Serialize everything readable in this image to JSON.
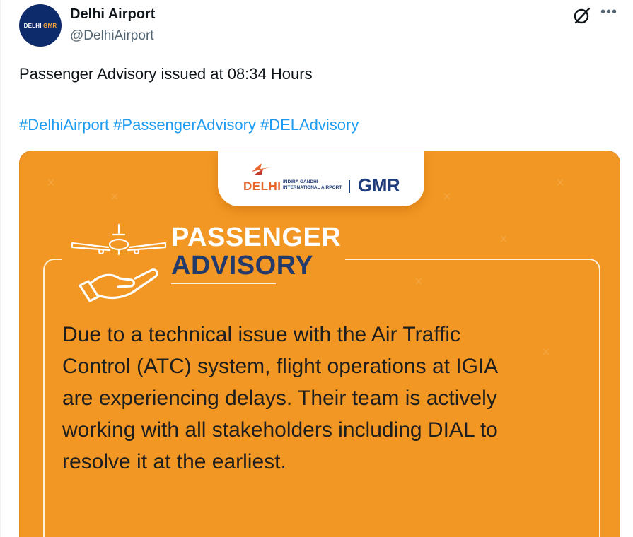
{
  "author": {
    "display_name": "Delhi Airport",
    "handle": "@DelhiAirport",
    "avatar_text_delhi": "DELHI",
    "avatar_text_gmr": "GMR"
  },
  "tweet": {
    "text": "Passenger Advisory issued at 08:34 Hours",
    "hashtags": [
      "#DelhiAirport",
      "#PassengerAdvisory",
      "#DELAdvisory"
    ]
  },
  "actions": {
    "grok_icon": "grok-icon",
    "more_icon": "more-icon"
  },
  "card": {
    "logo": {
      "delhi": "DELHI",
      "sub_line_1": "INDIRA GANDHI",
      "sub_line_2": "INTERNATIONAL AIRPORT",
      "gmr": "GMR"
    },
    "title_line_1": "PASSENGER",
    "title_line_2": "ADVISORY",
    "body": "Due to a technical issue with the Air Traffic Control (ATC) system, flight operations at IGIA are experiencing delays. Their team is actively working with all stakeholders including DIAL to resolve it at the earliest.",
    "colors": {
      "background": "#f29724",
      "title_white": "#ffffff",
      "title_navy": "#233a6b",
      "body_text": "#1e1e1e"
    }
  },
  "colors": {
    "link": "#1d9bf0",
    "secondary_text": "#536471"
  }
}
